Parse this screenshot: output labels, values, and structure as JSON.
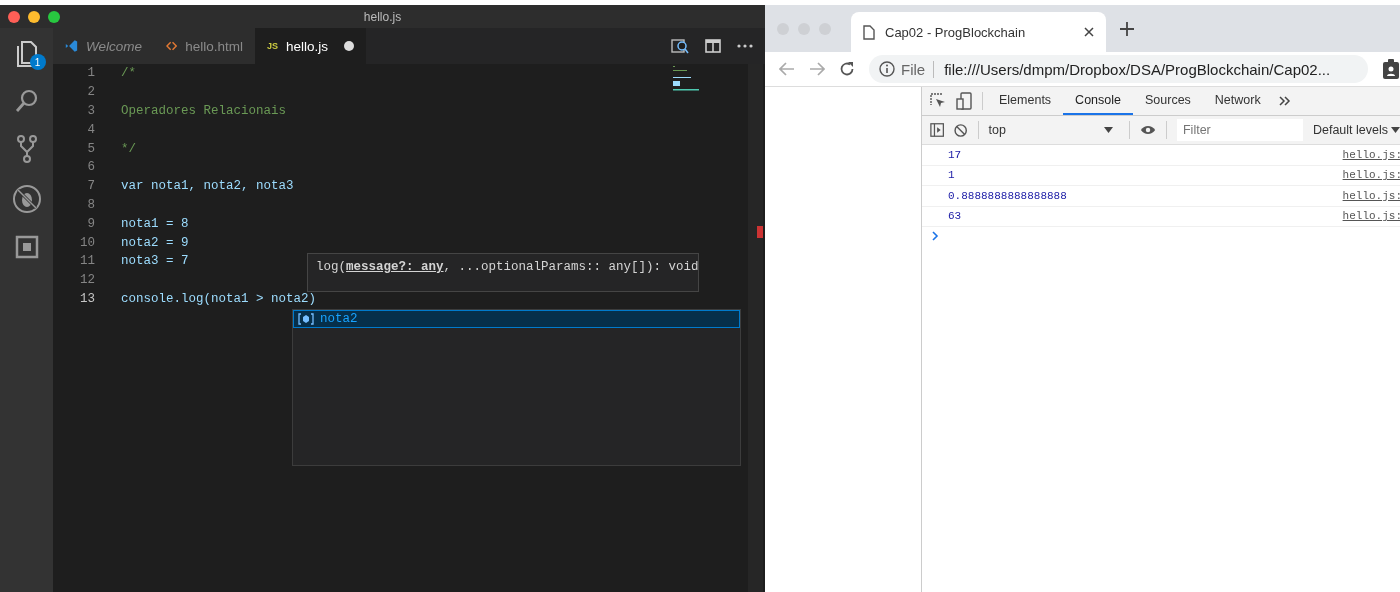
{
  "editor": {
    "title": "hello.js",
    "explorer_badge": "1",
    "tabs": [
      {
        "label": "Welcome",
        "kind": "welcome",
        "selected": false,
        "dirty": false
      },
      {
        "label": "hello.html",
        "kind": "html",
        "selected": false,
        "dirty": false
      },
      {
        "label": "hello.js",
        "kind": "js",
        "badge": "JS",
        "selected": true,
        "dirty": true
      }
    ],
    "lines": [
      {
        "number": "1",
        "text": "/*",
        "kind": "comment",
        "current": false
      },
      {
        "number": "2",
        "current": false
      },
      {
        "number": "3",
        "text": "Operadores Relacionais",
        "kind": "comment",
        "current": false
      },
      {
        "number": "4",
        "current": false
      },
      {
        "number": "5",
        "text": "*/",
        "kind": "comment",
        "current": false
      },
      {
        "number": "6",
        "current": false
      },
      {
        "number": "7",
        "text": "var nota1, nota2, nota3",
        "kind": "code",
        "current": false
      },
      {
        "number": "8",
        "current": false
      },
      {
        "number": "9",
        "text": "nota1 = 8",
        "kind": "code",
        "current": false
      },
      {
        "number": "10",
        "text": "nota2 = 9",
        "kind": "code",
        "current": false
      },
      {
        "number": "11",
        "text": "nota3 = 7",
        "kind": "code",
        "current": false
      },
      {
        "number": "12",
        "current": false
      },
      {
        "number": "13",
        "text": "console.log(nota1 > nota2)",
        "kind": "code",
        "current": true
      }
    ],
    "hint": "log(**message?: any**, ...optionalParams:: any[]): void",
    "suggestions": [
      {
        "label": "nota2",
        "selected": true
      }
    ]
  },
  "browser": {
    "tab": {
      "title": "Cap02 - ProgBlockchain"
    },
    "address": {
      "scheme": "File",
      "url": "file:///Users/dmpm/Dropbox/DSA/ProgBlockchain/Cap02..."
    },
    "devtools": {
      "tabs": [
        {
          "label": "Elements",
          "selected": false
        },
        {
          "label": "Console",
          "selected": true
        },
        {
          "label": "Sources",
          "selected": false
        },
        {
          "label": "Network",
          "selected": false
        }
      ],
      "context": "top",
      "filter_placeholder": "Filter",
      "levels": "Default levels",
      "messages": [
        {
          "value": "17",
          "source": "hello.js:"
        },
        {
          "value": "1",
          "source": "hello.js:"
        },
        {
          "value": "0.8888888888888888",
          "source": "hello.js:"
        },
        {
          "value": "63",
          "source": "hello.js:"
        }
      ]
    }
  }
}
